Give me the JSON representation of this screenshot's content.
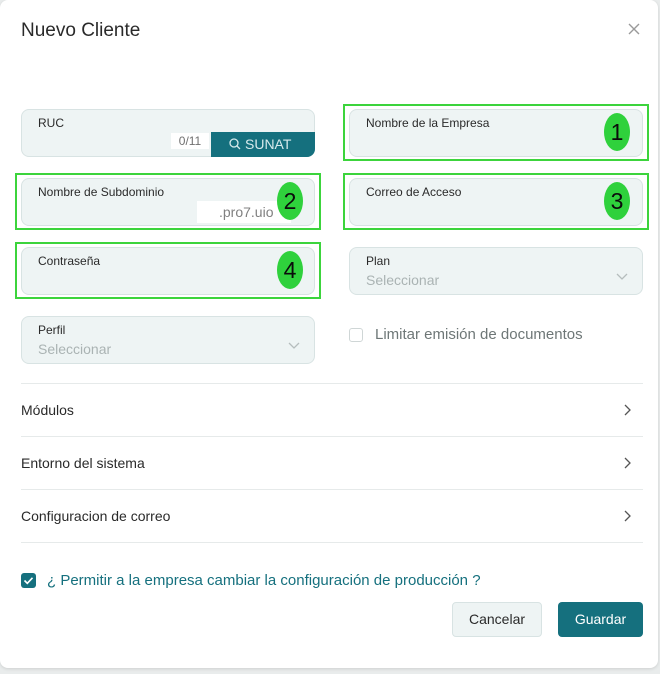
{
  "dialog": {
    "title": "Nuevo Cliente"
  },
  "fields": {
    "ruc": {
      "label": "RUC",
      "counter": "0/11",
      "search_button": "SUNAT"
    },
    "nombre_empresa": {
      "label": "Nombre de la Empresa"
    },
    "subdominio": {
      "label": "Nombre de Subdominio",
      "suffix": ".pro7.uio"
    },
    "correo": {
      "label": "Correo de Acceso"
    },
    "contrasena": {
      "label": "Contraseña"
    },
    "plan": {
      "label": "Plan",
      "placeholder": "Seleccionar"
    },
    "perfil": {
      "label": "Perfil",
      "placeholder": "Seleccionar"
    }
  },
  "limit_docs": {
    "label": "Limitar emisión de documentos",
    "checked": false
  },
  "sections": [
    "Módulos",
    "Entorno del sistema",
    "Configuracion de correo"
  ],
  "permission": {
    "label": "¿ Permitir a la empresa cambiar la configuración de producción ?",
    "checked": true
  },
  "buttons": {
    "cancel": "Cancelar",
    "save": "Guardar"
  },
  "annotations": [
    "1",
    "2",
    "3",
    "4"
  ],
  "colors": {
    "primary": "#15707e",
    "highlight": "#3cd43c",
    "badge": "#2fd13c"
  }
}
